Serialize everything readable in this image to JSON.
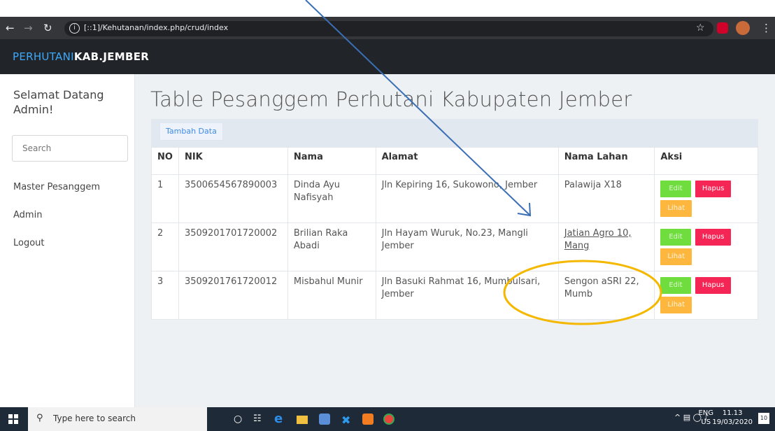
{
  "browser": {
    "url": "[::1]/Kehutanan/index.php/crud/index",
    "info_glyph": "i"
  },
  "navbar": {
    "brand_part1": "PERHUTANI",
    "brand_part2": "KAB.JEMBER"
  },
  "sidebar": {
    "welcome": "Selamat Datang Admin!",
    "search_placeholder": "Search",
    "links": [
      {
        "label": "Master Pesanggem"
      },
      {
        "label": "Admin"
      },
      {
        "label": "Logout"
      }
    ]
  },
  "main": {
    "title": "Table Pesanggem Perhutani Kabupaten Jember",
    "add_button": "Tambah Data",
    "table": {
      "headers": [
        "NO",
        "NIK",
        "Nama",
        "Alamat",
        "Nama Lahan",
        "Aksi"
      ],
      "rows": [
        {
          "no": "1",
          "nik": "3500654567890003",
          "nama": "Dinda Ayu Nafisyah",
          "alamat": "Jln Kepiring 16, Sukowono, Jember",
          "lahan": "Palawija X18"
        },
        {
          "no": "2",
          "nik": "3509201701720002",
          "nama": "Brilian Raka Abadi",
          "alamat": "Jln Hayam Wuruk, No.23, Mangli Jember",
          "lahan": "Jatian Agro 10, Mang"
        },
        {
          "no": "3",
          "nik": "3509201761720012",
          "nama": "Misbahul Munir",
          "alamat": "Jln Basuki Rahmat 16, Mumbulsari, Jember",
          "lahan": "Sengon aSRI 22, Mumb"
        }
      ],
      "actions": {
        "edit": "Edit",
        "delete": "Hapus",
        "view": "Lihat"
      }
    }
  },
  "taskbar": {
    "search_placeholder": "Type here to search",
    "lang_top": "ENG",
    "lang_bottom": "US",
    "time": "11.13",
    "date": "19/03/2020",
    "notif_count": "10"
  },
  "colors": {
    "accent_blue": "#3da9fc",
    "edit_green": "#6fdd3e",
    "delete_red": "#f52655",
    "view_orange": "#fdb73f",
    "annotation_arrow": "#3b6fb5",
    "annotation_circle": "#f5b800"
  }
}
